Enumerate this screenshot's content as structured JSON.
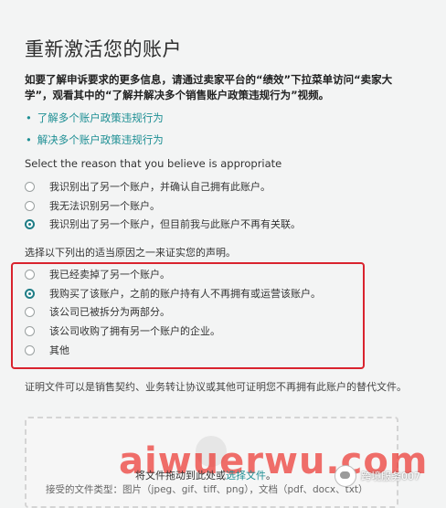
{
  "title": "重新激活您的账户",
  "intro": "如要了解申诉要求的更多信息，请通过卖家平台的“绩效”下拉菜单访问“卖家大学”，观看其中的“了解并解决多个销售账户政策违规行为”视频。",
  "links": [
    {
      "label": "了解多个账户政策违规行为"
    },
    {
      "label": "解决多个账户政策违规行为"
    }
  ],
  "reason_question": "Select the reason that you believe is appropriate",
  "reason_options": [
    {
      "label": "我识别出了另一个账户，并确认自己拥有此账户。",
      "selected": false
    },
    {
      "label": "我无法识别另一个账户。",
      "selected": false
    },
    {
      "label": "我识别出了另一个账户，但目前我与此账户不再有关联。",
      "selected": true
    }
  ],
  "cause_question": "选择以下列出的适当原因之一来证实您的声明。",
  "cause_options": [
    {
      "label": "我已经卖掉了另一个账户。",
      "selected": false
    },
    {
      "label": "我购买了该账户，之前的账户持有人不再拥有或运营该账户。",
      "selected": true
    },
    {
      "label": "该公司已被拆分为两部分。",
      "selected": false
    },
    {
      "label": "该公司收购了拥有另一个账户的企业。",
      "selected": false
    },
    {
      "label": "其他",
      "selected": false
    }
  ],
  "proof_text": "证明文件可以是销售契约、业务转让协议或其他可证明您不再拥有此账户的替代文件。",
  "upload": {
    "text_before": "将文件拖动到此处或",
    "link": "选择文件",
    "text_after": "。",
    "accepted": "接受的文件类型：图片（jpeg、gif、tiff、png），文档（pdf、docx、txt）"
  },
  "watermark": {
    "site": "aiwuerwu.com",
    "badge": "跨境服务007"
  },
  "colors": {
    "accent": "#1f7d86",
    "link": "#1e8f94",
    "highlight_box": "#d9232e"
  }
}
